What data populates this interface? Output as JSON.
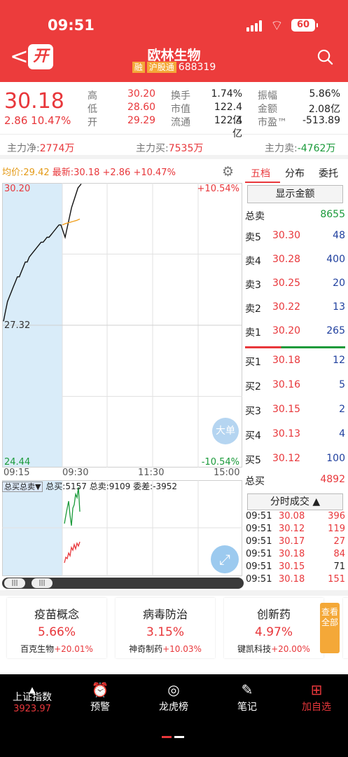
{
  "status": {
    "time": "09:51",
    "battery": "60"
  },
  "header": {
    "back": "<",
    "app_badge": "开",
    "name": "欧林生物",
    "tag1": "融",
    "tag2": "沪股通",
    "code": "688319"
  },
  "quote": {
    "price": "30.18",
    "change": "2.86 10.47%",
    "fields": [
      {
        "label": "高",
        "value": "30.20",
        "color": "red"
      },
      {
        "label": "低",
        "value": "28.60",
        "color": "red"
      },
      {
        "label": "开",
        "value": "29.29",
        "color": "red"
      },
      {
        "label": "换手",
        "value": "1.74%",
        "color": "dark"
      },
      {
        "label": "市值",
        "value": "122.4亿",
        "color": "dark"
      },
      {
        "label": "流通",
        "value": "122.4亿",
        "color": "dark"
      },
      {
        "label": "振幅",
        "value": "5.86%",
        "color": "dark"
      },
      {
        "label": "金额",
        "value": "2.08亿",
        "color": "dark"
      },
      {
        "label": "市盈™",
        "value": "-513.89",
        "color": "dark"
      }
    ]
  },
  "flow": {
    "net_label": "主力净:",
    "net": "2774万",
    "buy_label": "主力买:",
    "buy": "7535万",
    "sell_label": "主力卖:",
    "sell": "-4762万"
  },
  "chart_info": {
    "avg_label": "均价:",
    "avg": "29.42",
    "latest_label": "最新:",
    "latest": "30.18 +2.86 +10.47%"
  },
  "chart_data": {
    "type": "line",
    "y_max_label": "30.20",
    "y_mid_label": "27.32",
    "y_min_label": "24.44",
    "pct_max": "+10.54%",
    "pct_min": "-10.54%",
    "x_ticks": [
      "09:15",
      "09:30",
      "11:30",
      "15:00"
    ],
    "ylim": [
      24.44,
      30.2
    ],
    "series": [
      {
        "name": "最新",
        "values": [
          27.4,
          27.6,
          27.8,
          27.9,
          28.0,
          28.1,
          28.2,
          28.3,
          28.3,
          28.4,
          28.5,
          28.6,
          28.6,
          28.7,
          28.75,
          28.8,
          28.85,
          28.9,
          28.95,
          29.0,
          29.0,
          29.05,
          29.1,
          29.1,
          29.15,
          29.2,
          29.25,
          29.3,
          29.35,
          29.35,
          29.1,
          29.4,
          29.7,
          29.9,
          30.1,
          30.18
        ]
      },
      {
        "name": "均价",
        "values": [
          29.35,
          29.38,
          29.4,
          29.42,
          29.44,
          29.47
        ]
      }
    ]
  },
  "big_btn": "大单",
  "vol": {
    "box": "总买总卖▼",
    "buy_label": "总买:",
    "buy": "5157",
    "sell_label": "总卖:",
    "sell": "9109",
    "diff_label": "委差:",
    "diff": "-3952"
  },
  "side": {
    "tabs": [
      "五档",
      "分布",
      "委托"
    ],
    "show_amount": "显示金额",
    "total_sell_label": "总卖",
    "total_sell": "8655",
    "total_buy_label": "总买",
    "total_buy": "4892",
    "asks": [
      {
        "l": "卖5",
        "p": "30.30",
        "v": "48"
      },
      {
        "l": "卖4",
        "p": "30.28",
        "v": "400"
      },
      {
        "l": "卖3",
        "p": "30.25",
        "v": "20"
      },
      {
        "l": "卖2",
        "p": "30.22",
        "v": "13"
      },
      {
        "l": "卖1",
        "p": "30.20",
        "v": "265"
      }
    ],
    "bids": [
      {
        "l": "买1",
        "p": "30.18",
        "v": "12"
      },
      {
        "l": "买2",
        "p": "30.16",
        "v": "5"
      },
      {
        "l": "买3",
        "p": "30.15",
        "v": "2"
      },
      {
        "l": "买4",
        "p": "30.13",
        "v": "4"
      },
      {
        "l": "买5",
        "p": "30.12",
        "v": "100"
      }
    ],
    "ticks_btn": "分时成交 ▲",
    "ticks": [
      {
        "t": "09:51",
        "p": "30.08",
        "v": "396"
      },
      {
        "t": "09:51",
        "p": "30.12",
        "v": "119"
      },
      {
        "t": "09:51",
        "p": "30.17",
        "v": "27"
      },
      {
        "t": "09:51",
        "p": "30.18",
        "v": "84"
      },
      {
        "t": "09:51",
        "p": "30.15",
        "v": "71"
      },
      {
        "t": "09:51",
        "p": "30.18",
        "v": "151"
      }
    ]
  },
  "cards": [
    {
      "name": "疫苗概念",
      "chg": "5.66%",
      "stock": "百克生物",
      "stock_chg": "+20.01%"
    },
    {
      "name": "病毒防治",
      "chg": "3.15%",
      "stock": "神奇制药",
      "stock_chg": "+10.03%"
    },
    {
      "name": "创新药",
      "chg": "4.97%",
      "stock": "键凯科技",
      "stock_chg": "+20.00%"
    }
  ],
  "view_all": "查看全部",
  "nav": {
    "index_label": "上证指数",
    "index_val": "3923.97",
    "items": [
      "预警",
      "龙虎榜",
      "笔记",
      "加自选"
    ]
  }
}
